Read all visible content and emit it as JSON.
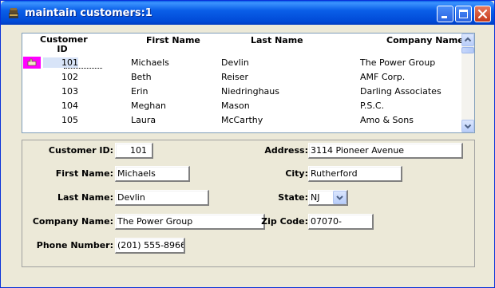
{
  "window": {
    "title": "maintain customers:1"
  },
  "list": {
    "columns": [
      "Customer ID",
      "First Name",
      "Last Name",
      "Company Name"
    ],
    "rows": [
      {
        "id": "101",
        "first": "Michaels",
        "last": "Devlin",
        "company": "The Power Group"
      },
      {
        "id": "102",
        "first": "Beth",
        "last": "Reiser",
        "company": "AMF Corp."
      },
      {
        "id": "103",
        "first": "Erin",
        "last": "Niedringhaus",
        "company": "Darling Associates"
      },
      {
        "id": "104",
        "first": "Meghan",
        "last": "Mason",
        "company": "P.S.C."
      },
      {
        "id": "105",
        "first": "Laura",
        "last": "McCarthy",
        "company": "Amo & Sons"
      }
    ]
  },
  "form": {
    "customer_id_label": "Customer ID:",
    "customer_id": "101",
    "first_name_label": "First Name:",
    "first_name": "Michaels",
    "last_name_label": "Last Name:",
    "last_name": "Devlin",
    "company_name_label": "Company Name:",
    "company_name": "The Power Group",
    "phone_label": "Phone Number:",
    "phone": "(201) 555-8966",
    "address_label": "Address:",
    "address": "3114 Pioneer Avenue",
    "city_label": "City:",
    "city": "Rutherford",
    "state_label": "State:",
    "state": "NJ",
    "zip_label": "Zip Code:",
    "zip": "07070-"
  },
  "icons": {
    "app": "app-icon",
    "row_indicator": "hand-pointer-icon"
  },
  "colors": {
    "titlebar": "#0a5fe8",
    "window_bg": "#ece9d8",
    "indicator": "#ff00ff"
  }
}
